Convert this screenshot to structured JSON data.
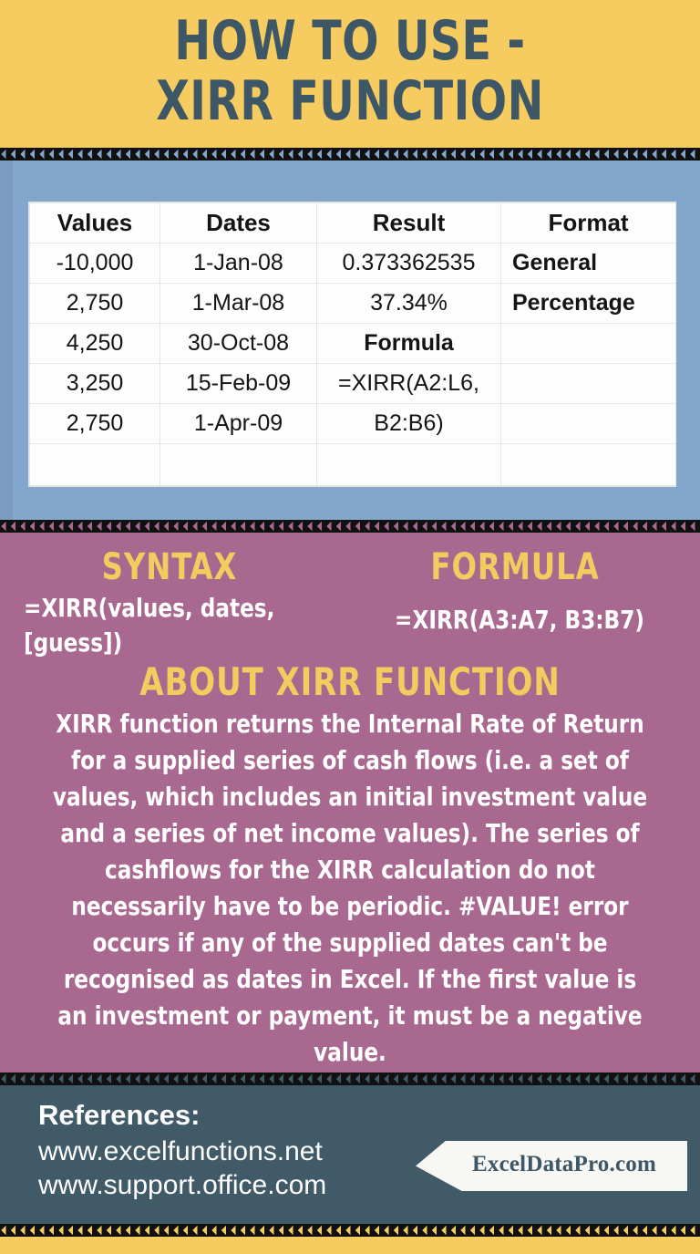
{
  "header": {
    "title_line1": "HOW TO USE -",
    "title_line2": "XIRR FUNCTION",
    "bg_color": "#F6CC60",
    "text_color": "#3D5766"
  },
  "table_section": {
    "bg_color": "#83A6CC",
    "table": {
      "columns": [
        "Values",
        "Dates",
        "Result",
        "Format"
      ],
      "rows": [
        [
          "-10,000",
          "1-Jan-08",
          "0.373362535",
          "General"
        ],
        [
          "2,750",
          "1-Mar-08",
          "37.34%",
          "Percentage"
        ],
        [
          "4,250",
          "30-Oct-08",
          "Formula",
          ""
        ],
        [
          "3,250",
          "15-Feb-09",
          "=XIRR(A2:L6,",
          ""
        ],
        [
          "2,750",
          "1-Apr-09",
          "B2:B6)",
          ""
        ],
        [
          "",
          "",
          "",
          ""
        ]
      ]
    }
  },
  "about_section": {
    "bg_color": "#A8688F",
    "accent_color": "#F2CC5E",
    "syntax_heading": "SYNTAX",
    "syntax_text": "=XIRR(values, dates, [guess])",
    "formula_heading": "FORMULA",
    "formula_text": "=XIRR(A3:A7, B3:B7)",
    "about_heading": "ABOUT XIRR FUNCTION",
    "about_text": "XIRR function returns the Internal Rate of Return for a supplied series of cash flows (i.e. a set of values, which includes an initial investment value and a series of net income values). The series of cashflows for the XIRR calculation do not necessarily have to be periodic. #VALUE! error occurs if any of the supplied dates can't be recognised as dates in Excel. If the first value is an investment or payment, it must be a negative value."
  },
  "footer": {
    "bg_color": "#415A68",
    "references_label": "References:",
    "references": [
      "www.excelfunctions.net",
      "www.support.office.com"
    ],
    "badge_text": "ExcelDataPro.com"
  }
}
